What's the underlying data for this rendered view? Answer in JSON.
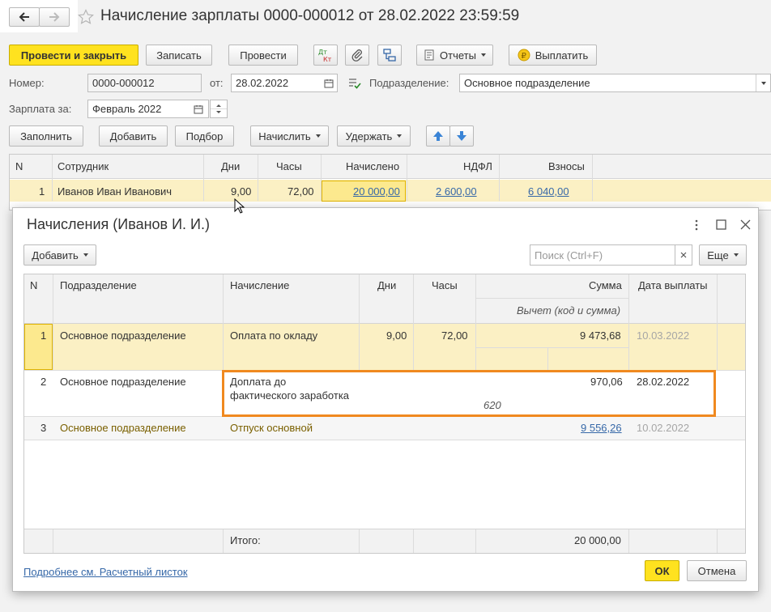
{
  "window": {
    "title": "Начисление зарплаты 0000-000012 от 28.02.2022 23:59:59"
  },
  "toolbar": {
    "post_close": "Провести и закрыть",
    "save": "Записать",
    "post": "Провести",
    "reports": "Отчеты",
    "pay": "Выплатить"
  },
  "form": {
    "number_label": "Номер:",
    "number_value": "0000-000012",
    "date_label": "от:",
    "date_value": "28.02.2022",
    "department_label": "Подразделение:",
    "department_value": "Основное подразделение",
    "salary_for_label": "Зарплата за:",
    "salary_for_value": "Февраль 2022"
  },
  "table_toolbar": {
    "fill": "Заполнить",
    "add": "Добавить",
    "pick": "Подбор",
    "accrue": "Начислить",
    "withhold": "Удержать"
  },
  "main_table": {
    "headers": [
      "N",
      "Сотрудник",
      "Дни",
      "Часы",
      "Начислено",
      "НДФЛ",
      "Взносы"
    ],
    "rows": [
      {
        "n": "1",
        "employee": "Иванов Иван Иванович",
        "days": "9,00",
        "hours": "72,00",
        "accrued": "20 000,00",
        "ndfl": "2 600,00",
        "contrib": "6 040,00"
      }
    ]
  },
  "dialog": {
    "title": "Начисления (Иванов И. И.)",
    "add": "Добавить",
    "search_placeholder": "Поиск (Ctrl+F)",
    "more": "Еще",
    "headers": {
      "n": "N",
      "department": "Подразделение",
      "accrual": "Начисление",
      "days": "Дни",
      "hours": "Часы",
      "sum": "Сумма",
      "deduction": "Вычет (код и сумма)",
      "pay_date": "Дата выплаты"
    },
    "rows": [
      {
        "n": "1",
        "department": "Основное подразделение",
        "accrual": "Оплата по окладу",
        "days": "9,00",
        "hours": "72,00",
        "sum": "9 473,68",
        "deduction": "",
        "pay_date": "10.03.2022"
      },
      {
        "n": "2",
        "department": "Основное подразделение",
        "accrual_line1": "Доплата до",
        "accrual_line2": "фактического заработка",
        "days": "",
        "hours": "",
        "sum": "970,06",
        "deduction": "620",
        "pay_date": "28.02.2022"
      },
      {
        "n": "3",
        "department": "Основное подразделение",
        "accrual": "Отпуск основной",
        "days": "",
        "hours": "",
        "sum": "9 556,26",
        "deduction": "",
        "pay_date": "10.02.2022"
      }
    ],
    "total_label": "Итого:",
    "total_value": "20 000,00",
    "footer_link": "Подробнее см. Расчетный листок",
    "ok": "ОК",
    "cancel": "Отмена"
  },
  "colors": {
    "primary_yellow": "#ffe21f",
    "selected_row": "#fbf0c4",
    "highlight_border": "#f0891f",
    "link": "#3668a8"
  }
}
